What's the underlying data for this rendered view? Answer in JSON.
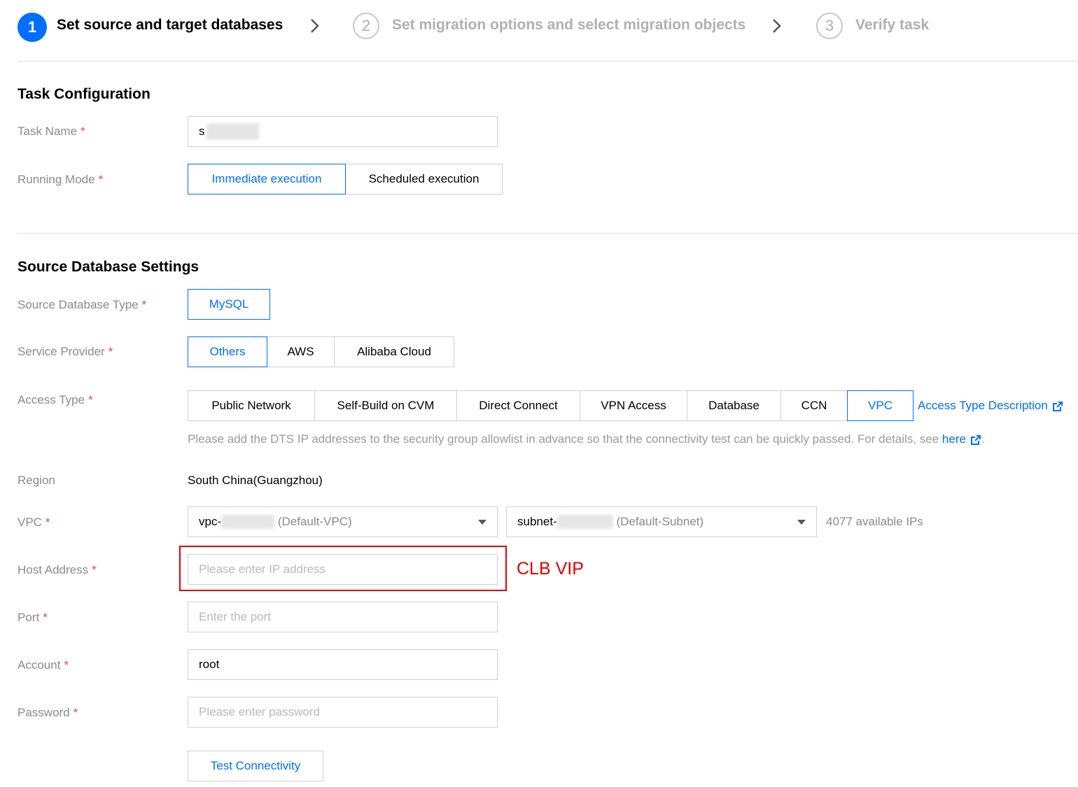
{
  "steps": [
    {
      "num": "1",
      "label": "Set source and target databases"
    },
    {
      "num": "2",
      "label": "Set migration options and select migration objects"
    },
    {
      "num": "3",
      "label": "Verify task"
    }
  ],
  "task_config": {
    "title": "Task Configuration",
    "task_name_label": "Task Name",
    "task_name_value": "s",
    "running_mode_label": "Running Mode",
    "running_modes": [
      "Immediate execution",
      "Scheduled execution"
    ],
    "running_mode_selected": "Immediate execution"
  },
  "source_db": {
    "title": "Source Database Settings",
    "db_type_label": "Source Database Type",
    "db_types": [
      "MySQL"
    ],
    "provider_label": "Service Provider",
    "providers": [
      "Others",
      "AWS",
      "Alibaba Cloud"
    ],
    "provider_selected": "Others",
    "access_type_label": "Access Type",
    "access_types": [
      "Public Network",
      "Self-Build on CVM",
      "Direct Connect",
      "VPN Access",
      "Database",
      "CCN",
      "VPC"
    ],
    "access_type_selected": "VPC",
    "access_type_desc_link": "Access Type Description",
    "hint_text": "Please add the DTS IP addresses to the security group allowlist in advance so that the connectivity test can be quickly passed. For details, see",
    "hint_link": "here",
    "hint_end": ".",
    "region_label": "Region",
    "region_value": "South China(Guangzhou)",
    "vpc_label": "VPC",
    "vpc_prefix": "vpc-",
    "vpc_suffix": "(Default-VPC)",
    "subnet_prefix": "subnet-",
    "subnet_suffix": "(Default-Subnet)",
    "available_ips": "4077 available IPs",
    "host_label": "Host Address",
    "host_placeholder": "Please enter IP address",
    "annotation": "CLB VIP",
    "port_label": "Port",
    "port_placeholder": "Enter the port",
    "account_label": "Account",
    "account_value": "root",
    "password_label": "Password",
    "password_placeholder": "Please enter password",
    "test_button": "Test Connectivity"
  },
  "colors": {
    "accent": "#006eff",
    "required": "#e54545",
    "annotation": "#e00000"
  }
}
